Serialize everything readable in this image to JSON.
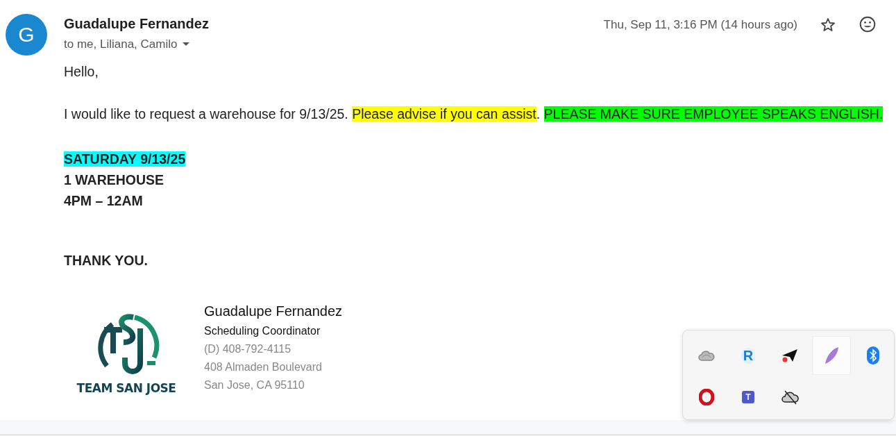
{
  "email": {
    "avatar_letter": "G",
    "sender": "Guadalupe Fernandez",
    "recipients": "to me, Liliana, Camilo",
    "date": "Thu, Sep 11, 3:16 PM (14 hours ago)",
    "starred": false
  },
  "body": [
    {
      "kind": "paragraph",
      "segments": [
        {
          "text": "Hello,"
        }
      ]
    },
    {
      "kind": "paragraph",
      "segments": [
        {
          "text": "I would like to request a warehouse for 9/13/25. "
        },
        {
          "text": "Please advise if you can assist",
          "color": "#ffff00"
        },
        {
          "text": ". "
        },
        {
          "text": "PLEASE MAKE SURE EMPLOYEE SPEAKS ENGLISH.",
          "color": "#00ff00"
        }
      ]
    },
    {
      "kind": "bold",
      "segments": [
        {
          "text": "SATURDAY 9/13/25",
          "color": "#00ffff"
        }
      ]
    },
    {
      "kind": "bold",
      "segments": [
        {
          "text": "1 WAREHOUSE"
        }
      ]
    },
    {
      "kind": "bold",
      "segments": [
        {
          "text": "4PM – 12AM"
        }
      ]
    },
    {
      "kind": "thanks",
      "segments": [
        {
          "text": "THANK YOU."
        }
      ]
    }
  ],
  "signature": {
    "logo_text": "TEAM SAN JOSE",
    "name": "Guadalupe Fernandez",
    "title": "Scheduling Coordinator",
    "lines": [
      "(D) 408-792-4115",
      "408 Almaden Boulevard",
      "San Jose, CA 95110"
    ]
  },
  "tray": [
    {
      "kind": "cloud",
      "selected": false
    },
    {
      "kind": "r",
      "glyph": "R",
      "selected": false
    },
    {
      "kind": "plane",
      "selected": false
    },
    {
      "kind": "feather",
      "selected": true
    },
    {
      "kind": "bluetooth",
      "selected": false
    },
    {
      "kind": "opera",
      "selected": false
    },
    {
      "kind": "teams",
      "glyph": "T",
      "selected": false
    },
    {
      "kind": "cloud-off",
      "selected": false
    }
  ]
}
